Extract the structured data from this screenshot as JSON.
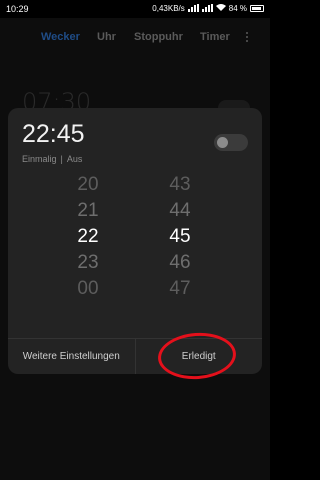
{
  "status_bar": {
    "time": "10:29",
    "network_speed": "0,43KB/s",
    "battery": "84 %"
  },
  "tabs": [
    {
      "label": "Wecker",
      "active": true
    },
    {
      "label": "Uhr",
      "active": false
    },
    {
      "label": "Stoppuhr",
      "active": false
    },
    {
      "label": "Timer",
      "active": false
    }
  ],
  "background_alarm": {
    "time": "07:30"
  },
  "dialog": {
    "time": "22:45",
    "repeat": "Einmalig",
    "state": "Aus",
    "toggle_on": false,
    "hours": [
      "20",
      "21",
      "22",
      "23",
      "00"
    ],
    "minutes": [
      "43",
      "44",
      "45",
      "46",
      "47"
    ],
    "selected_hour": "22",
    "selected_minute": "45",
    "more_settings_label": "Weitere Einstellungen",
    "done_label": "Erledigt"
  },
  "colors": {
    "accent": "#1f4c86",
    "annotation": "#e4101b",
    "dialog_bg": "#232323"
  }
}
